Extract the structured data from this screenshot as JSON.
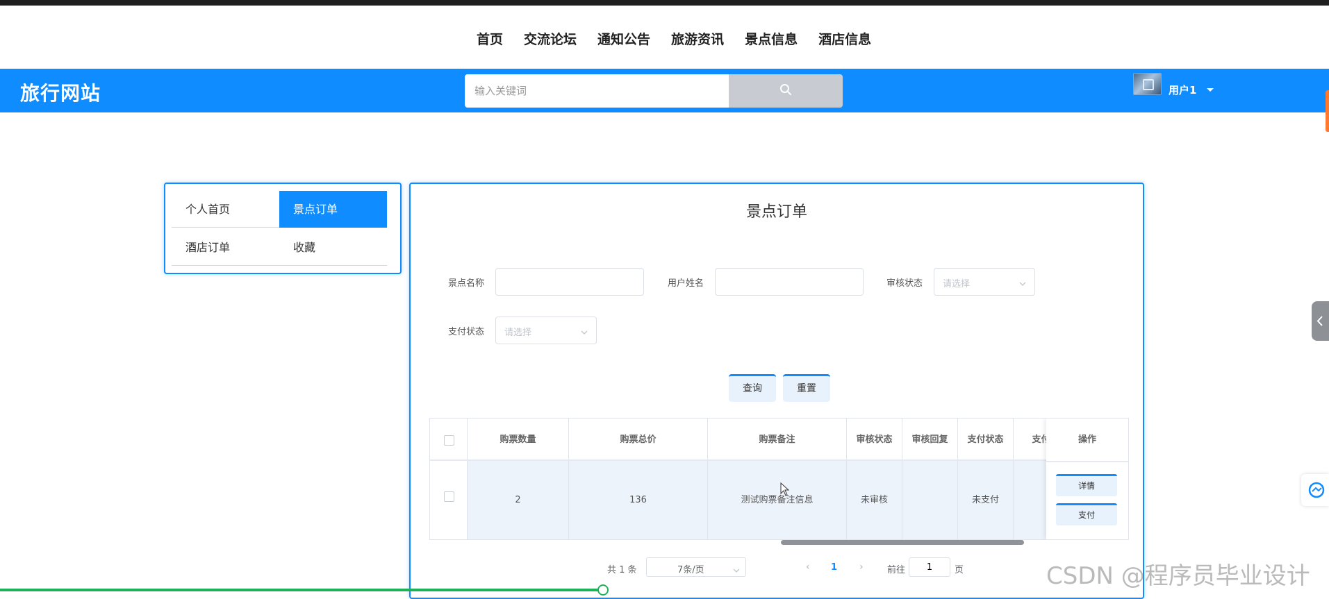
{
  "nav": {
    "items": [
      "首页",
      "交流论坛",
      "通知公告",
      "旅游资讯",
      "景点信息",
      "酒店信息"
    ]
  },
  "header": {
    "site_title": "旅行网站",
    "search_placeholder": "输入关键词",
    "search_icon": "search-icon",
    "user_name": "用户1"
  },
  "sidebar": {
    "items": [
      {
        "label": "个人首页",
        "active": false
      },
      {
        "label": "景点订单",
        "active": true
      },
      {
        "label": "酒店订单",
        "active": false
      },
      {
        "label": "收藏",
        "active": false
      }
    ]
  },
  "panel": {
    "title": "景点订单",
    "filters": {
      "spot_name_label": "景点名称",
      "user_name_label": "用户姓名",
      "audit_status_label": "审核状态",
      "audit_status_placeholder": "请选择",
      "pay_status_label": "支付状态",
      "pay_status_placeholder": "请选择"
    },
    "buttons": {
      "query": "查询",
      "reset": "重置"
    }
  },
  "table": {
    "columns": [
      "购票数量",
      "购票总价",
      "购票备注",
      "审核状态",
      "审核回复",
      "支付状态",
      "支付",
      "操作"
    ],
    "rows": [
      {
        "qty": "2",
        "total": "136",
        "remark": "测试购票备注信息",
        "audit_status": "未审核",
        "audit_reply": "",
        "pay_status": "未支付",
        "actions": [
          "详情",
          "支付"
        ]
      }
    ]
  },
  "pagination": {
    "total_text": "共 1 条",
    "page_size": "7条/页",
    "current_page": "1",
    "goto_label": "前往",
    "goto_value": "1",
    "page_suffix": "页"
  },
  "watermark": "CSDN @程序员毕业设计",
  "colors": {
    "primary": "#0f8cff",
    "row_bg": "#edf3fb",
    "button_bg": "#e8f2fd"
  }
}
